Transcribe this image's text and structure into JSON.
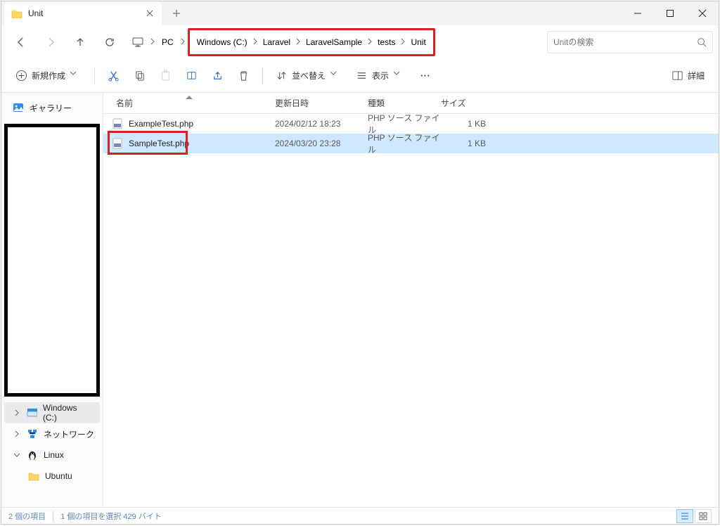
{
  "window": {
    "title": "Unit"
  },
  "breadcrumb": {
    "pc": "PC",
    "items": [
      "Windows (C:)",
      "Laravel",
      "LaravelSample",
      "tests",
      "Unit"
    ]
  },
  "search": {
    "placeholder": "Unitの検索"
  },
  "toolbar": {
    "new": "新規作成",
    "sort": "並べ替え",
    "view": "表示",
    "details": "詳細"
  },
  "sidebar": {
    "gallery": "ギャラリー",
    "windows_c": "Windows (C:)",
    "network": "ネットワーク",
    "linux": "Linux",
    "ubuntu": "Ubuntu"
  },
  "columns": {
    "name": "名前",
    "date": "更新日時",
    "type": "種類",
    "size": "サイズ"
  },
  "files": [
    {
      "name": "ExampleTest.php",
      "date": "2024/02/12 18:23",
      "type": "PHP ソース ファイル",
      "size": "1 KB",
      "selected": false
    },
    {
      "name": "SampleTest.php",
      "date": "2024/03/20 23:28",
      "type": "PHP ソース ファイル",
      "size": "1 KB",
      "selected": true
    }
  ],
  "status": {
    "count": "2 個の項目",
    "selection": "1 個の項目を選択 429 バイト"
  }
}
